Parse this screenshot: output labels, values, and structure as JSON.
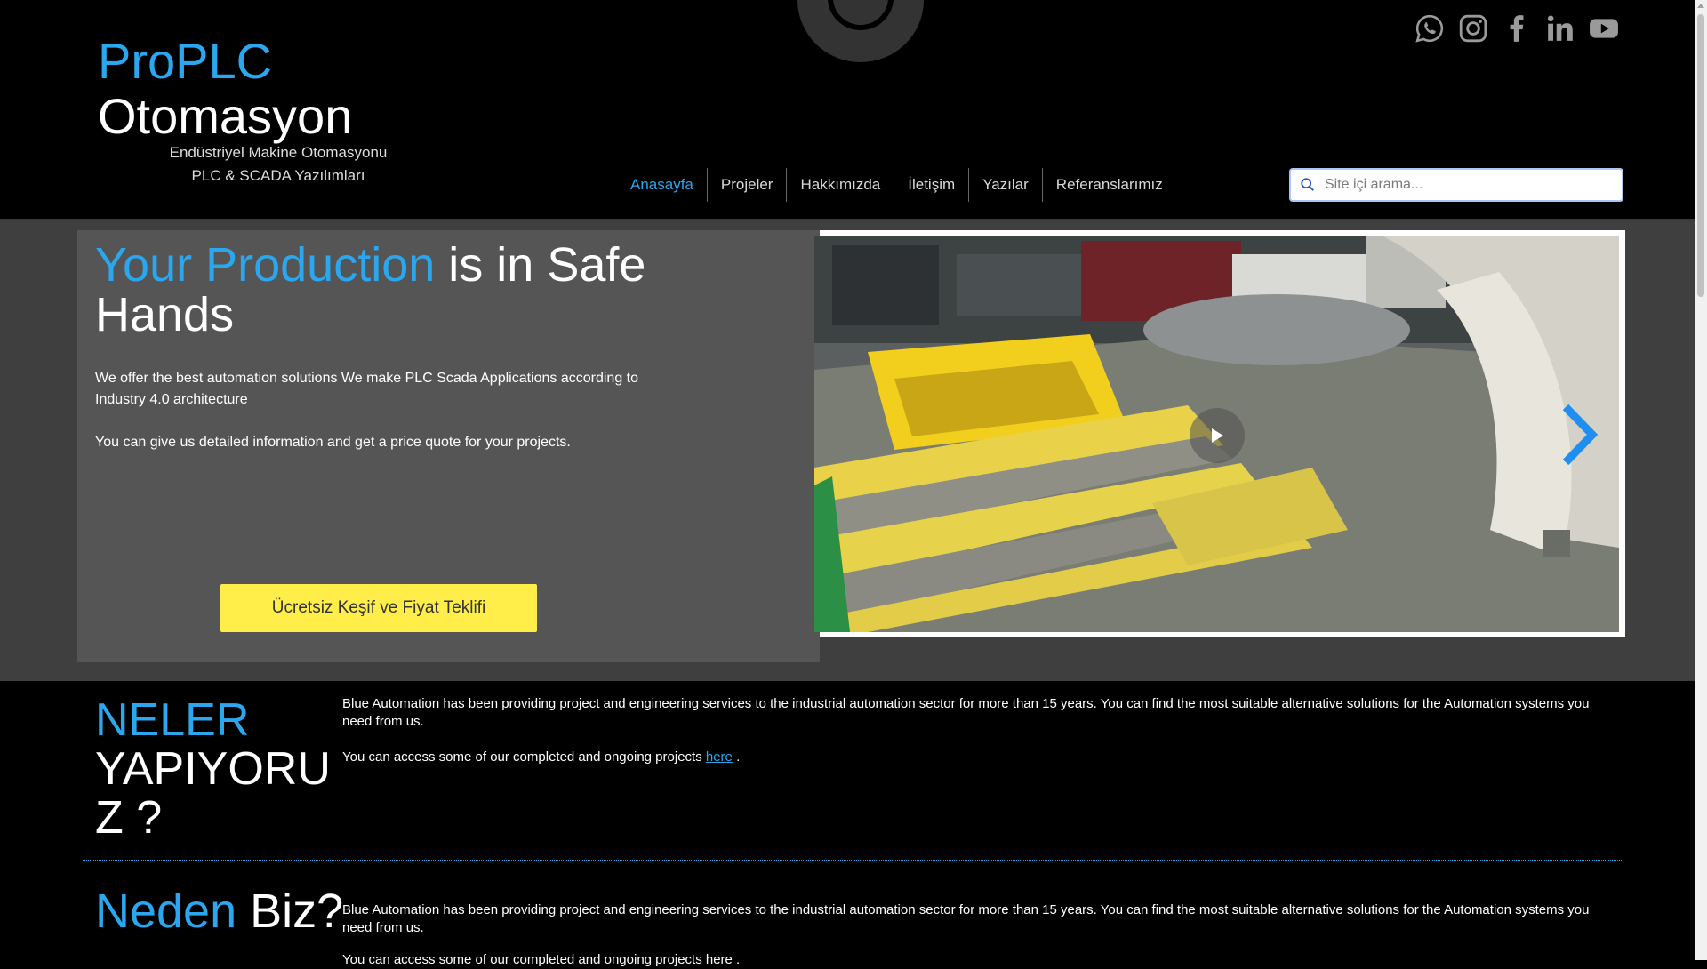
{
  "brand": {
    "line1": "ProPLC",
    "line2": "Otomasyon",
    "tagline1": "Endüstriyel Makine Otomasyonu",
    "tagline2": "PLC & SCADA Yazılımları",
    "accent_color": "#2aa7ee"
  },
  "socials": [
    "whatsapp-icon",
    "instagram-icon",
    "facebook-icon",
    "linkedin-icon",
    "youtube-icon"
  ],
  "nav": {
    "items": [
      "Anasayfa",
      "Projeler",
      "Hakkımızda",
      "İletişim",
      "Yazılar",
      "Referanslarımız"
    ],
    "active": "Anasayfa"
  },
  "search": {
    "placeholder": "Site içi arama..."
  },
  "hero": {
    "title_accent": "Your Production",
    "title_rest": " is in Safe Hands",
    "p1": "We offer the best automation solutions We make PLC Scada Applications according to Industry 4.0 architecture",
    "p2": "You can give us detailed information and get a price quote for your projects.",
    "cta": "Ücretsiz Keşif ve Fiyat Teklifi",
    "cta_color": "#ffee4a"
  },
  "section1": {
    "title_accent": "NELER",
    "title_rest": "YAPIYORUZ ?",
    "p1": "Blue Automation has been providing project and engineering services to the industrial automation sector for more than 15 years. You can find the most suitable alternative solutions for the Automation systems you need from us.",
    "p2_before": "You can access some of our completed and ongoing projects ",
    "p2_link": "here",
    "p2_after": " ."
  },
  "section2": {
    "title_accent": "Neden",
    "title_rest": " Biz?",
    "p1": "Blue Automation has been providing project and engineering services to the industrial automation sector for more than 15 years. You can find the most suitable alternative solutions for the Automation systems you need from us.",
    "p2": "You can access some of our completed and ongoing projects here ."
  }
}
